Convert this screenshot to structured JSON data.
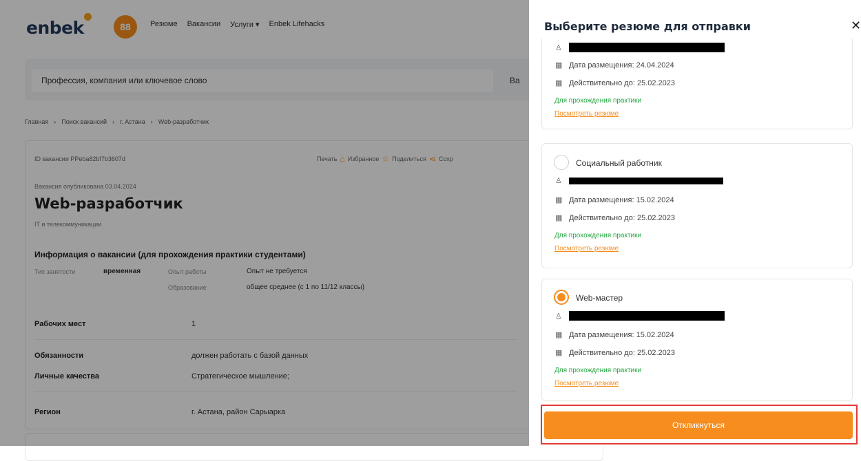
{
  "header": {
    "logo": "enbek",
    "app_icon": "88",
    "nav": [
      "Резюме",
      "Вакансии",
      "Услуги ▾",
      "Enbek Lifehacks"
    ]
  },
  "search": {
    "placeholder": "Профессия, компания или ключевое слово",
    "extra": "Ва"
  },
  "breadcrumb": [
    "Главная",
    "Поиск вакансий",
    "г. Астана",
    "Web-разработчик"
  ],
  "vacancy": {
    "id": "ID вакансии PPeba82bf7b3607d",
    "actions": [
      "Печать",
      "Избранное",
      "Поделиться",
      "Сохр"
    ],
    "published": "Вакансия опубликована 03.04.2024",
    "title": "Web-разработчик",
    "industry": "IT и телекоммуникации",
    "info_heading": "Информация о вакансии (для прохождения практики студентами)",
    "employment_label": "Тип занятости",
    "employment_value": "временная",
    "experience_label": "Опыт работы",
    "experience_value": "Опыт не требуется",
    "education_label": "Образование",
    "education_value": "общее среднее (с 1 по 11/12 классы)",
    "rows": [
      {
        "label": "Рабочих мест",
        "value": "1"
      },
      {
        "label": "Обязанности",
        "value": "должен работать с базой данных"
      },
      {
        "label": "Личные качества",
        "value": "Стратегическое мышление;"
      },
      {
        "label": "Регион",
        "value": "г. Астана, район Сарыарка"
      }
    ]
  },
  "modal": {
    "title": "Выберите резюме для отправки",
    "close": "✕",
    "resumes": [
      {
        "name": "",
        "posted": "Дата размещения: 24.04.2024",
        "valid": "Действительно до: 25.02.2023",
        "purpose": "Для прохождения практики",
        "link": "Посмотреть резюме",
        "selected": false
      },
      {
        "name": "Социальный работник",
        "posted": "Дата размещения: 15.02.2024",
        "valid": "Действительно до: 25.02.2023",
        "purpose": "Для прохождения практики",
        "link": "Посмотреть резюме",
        "selected": false
      },
      {
        "name": "Web-мастер",
        "posted": "Дата размещения: 15.02.2024",
        "valid": "Действительно до: 25.02.2023",
        "purpose": "Для прохождения практики",
        "link": "Посмотреть резюме",
        "selected": true
      }
    ],
    "apply_label": "Откликнуться"
  },
  "colors": {
    "accent": "#f78d1e",
    "highlight_border": "#e53935",
    "green": "#28a745"
  }
}
